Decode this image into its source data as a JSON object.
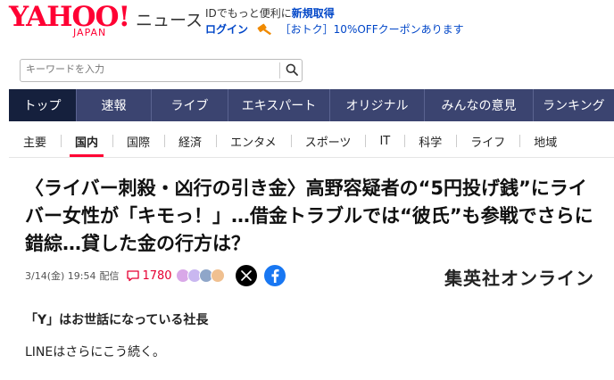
{
  "header": {
    "logo_text": "YAHOO!",
    "logo_sub": "JAPAN",
    "section": "ニュース",
    "promo_prefix": "IDでもっと便利に",
    "promo_link": "新規取得",
    "login_label": "ログイン",
    "coupon_label": "［おトク］10%OFFクーポンあります"
  },
  "search": {
    "placeholder": "キーワードを入力"
  },
  "nav": {
    "items": [
      {
        "label": "トップ",
        "active": true
      },
      {
        "label": "速報"
      },
      {
        "label": "ライブ"
      },
      {
        "label": "エキスパート"
      },
      {
        "label": "オリジナル"
      },
      {
        "label": "みんなの意見"
      },
      {
        "label": "ランキング"
      }
    ]
  },
  "subnav": {
    "items": [
      {
        "label": "主要"
      },
      {
        "label": "国内",
        "active": true
      },
      {
        "label": "国際"
      },
      {
        "label": "経済"
      },
      {
        "label": "エンタメ"
      },
      {
        "label": "スポーツ"
      },
      {
        "label": "IT"
      },
      {
        "label": "科学"
      },
      {
        "label": "ライフ"
      },
      {
        "label": "地域"
      }
    ]
  },
  "article": {
    "title": "〈ライバー刺殺・凶行の引き金〉高野容疑者の“5円投げ銭”にライバー女性が「キモっ！」…借金トラブルでは“彼氏”も参戦でさらに錯綜…貸した金の行方は？",
    "date": "3/14(金) 19:54",
    "date_suffix": "配信",
    "comment_count": "1780",
    "publisher": "集英社オンライン",
    "subheading": "「Y」はお世話になっている社長",
    "body": "LINEはさらにこう続く。"
  },
  "colors": {
    "brand_red": "#ff0033",
    "nav_bg": "#3b4470",
    "nav_active": "#15203d",
    "link_blue": "#0046c8",
    "facebook": "#1877f2"
  }
}
